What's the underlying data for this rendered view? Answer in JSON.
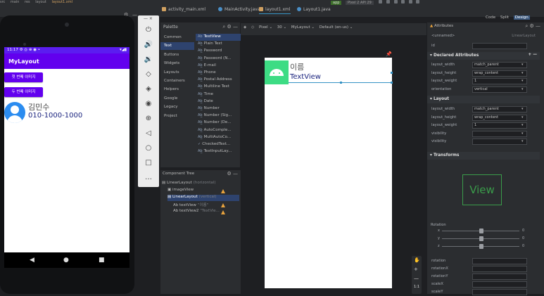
{
  "ide": {
    "breadcrumbs": [
      "src",
      "main",
      "res",
      "layout",
      "layout1.xml"
    ],
    "run_config": "app",
    "device": "Pixel 2 API 29",
    "view_modes": [
      "Code",
      "Split",
      "Design"
    ],
    "active_view_mode": "Design",
    "tabs": [
      {
        "label": "activity_main.xml",
        "color": "#d0a060"
      },
      {
        "label": "MainActivity.java",
        "color": "#4a8fc7"
      },
      {
        "label": "layout1.xml",
        "color": "#d0a060"
      },
      {
        "label": "Layout1.java",
        "color": "#4a8fc7"
      }
    ],
    "active_tab": "layout1.xml"
  },
  "phone": {
    "status_time": "11:17",
    "status_right": "▾◢▮",
    "app_title": "MyLayout",
    "button1": "첫 번째 이미지",
    "button2": "두 번째 이미지",
    "name": "김민수",
    "phone_number": "010-1000-1000",
    "nav": [
      "◀",
      "●",
      "■"
    ]
  },
  "emulator_toolbar": {
    "header": "—  ×",
    "icons": [
      "power-icon",
      "volume-up-icon",
      "volume-down-icon",
      "rotate-left-icon",
      "rotate-right-icon",
      "camera-icon",
      "zoom-in-icon",
      "back-icon",
      "home-icon",
      "overview-icon",
      "more-icon"
    ],
    "glyphs": [
      "⏻",
      "🔊",
      "🔉",
      "◇",
      "◈",
      "◉",
      "⊕",
      "◁",
      "○",
      "□",
      "…"
    ]
  },
  "palette": {
    "title": "Palette",
    "categories": [
      "Common",
      "Text",
      "Buttons",
      "Widgets",
      "Layouts",
      "Containers",
      "Helpers",
      "Google",
      "Legacy",
      "Project"
    ],
    "selected_category": "Text",
    "items": [
      "TextView",
      "Plain Text",
      "Password",
      "Password (N...",
      "E-mail",
      "Phone",
      "Postal Address",
      "Multiline Text",
      "Time",
      "Date",
      "Number",
      "Number (Sig...",
      "Number (De...",
      "AutoComple...",
      "MultiAutoCo...",
      "CheckedText...",
      "TextInputLay..."
    ],
    "item_prefixes": [
      "Ab",
      "Ab̲",
      "Ab̲",
      "Ab̲",
      "Ab̲",
      "Ab̲",
      "Ab̲",
      "Ab̲",
      "Ab̲",
      "Ab̲",
      "Ab̲",
      "Ab̲",
      "Ab̲",
      "Ab̲",
      "Ab̲",
      "✓",
      "Ab̲"
    ],
    "selected_item": "TextView"
  },
  "component_tree": {
    "title": "Component Tree",
    "nodes": [
      {
        "label": "LinearLayout",
        "hint": "(horizontal)",
        "depth": 0
      },
      {
        "label": "imageView",
        "hint": "",
        "depth": 1,
        "warn": true
      },
      {
        "label": "LinearLayout",
        "hint": "(vertical)",
        "depth": 1,
        "selected": true
      },
      {
        "label": "textView",
        "hint": "\"이름\"",
        "depth": 2,
        "warn": true
      },
      {
        "label": "textView2",
        "hint": "\"TextVie...",
        "depth": 2,
        "warn": true
      }
    ]
  },
  "canvas": {
    "toolbar": [
      "Pixel ⌄",
      "30 ⌄",
      "MyLayout ⌄",
      "Default (en-us) ⌄"
    ],
    "preview_name": "이름",
    "preview_text": "TextView",
    "zoom_controls": [
      "✋",
      "+",
      "—",
      "1:1"
    ]
  },
  "attributes": {
    "title": "Attributes",
    "element": "<unnamed>",
    "element_type": "LinearLayout",
    "id_label": "id",
    "declared_title": "Declared Attributes",
    "declared": [
      {
        "name": "layout_width",
        "value": "match_parent"
      },
      {
        "name": "layout_height",
        "value": "wrap_content"
      },
      {
        "name": "layout_weight",
        "value": "1"
      },
      {
        "name": "orientation",
        "value": "vertical"
      }
    ],
    "layout_title": "Layout",
    "layout": [
      {
        "name": "layout_width",
        "value": "match_parent"
      },
      {
        "name": "layout_height",
        "value": "wrap_content"
      },
      {
        "name": "layout_weight",
        "value": "1"
      },
      {
        "name": "visibility",
        "value": ""
      },
      {
        "name": "visibility",
        "value": ""
      }
    ],
    "transforms_title": "Transforms",
    "view_preview": "View",
    "rotation_label": "Rotation",
    "rotation_axes": [
      {
        "axis": "x",
        "value": "0"
      },
      {
        "axis": "y",
        "value": "0"
      },
      {
        "axis": "z",
        "value": "0"
      }
    ],
    "transform_fields": [
      "rotation",
      "rotationX",
      "rotationY",
      "scaleX",
      "scaleY"
    ]
  }
}
